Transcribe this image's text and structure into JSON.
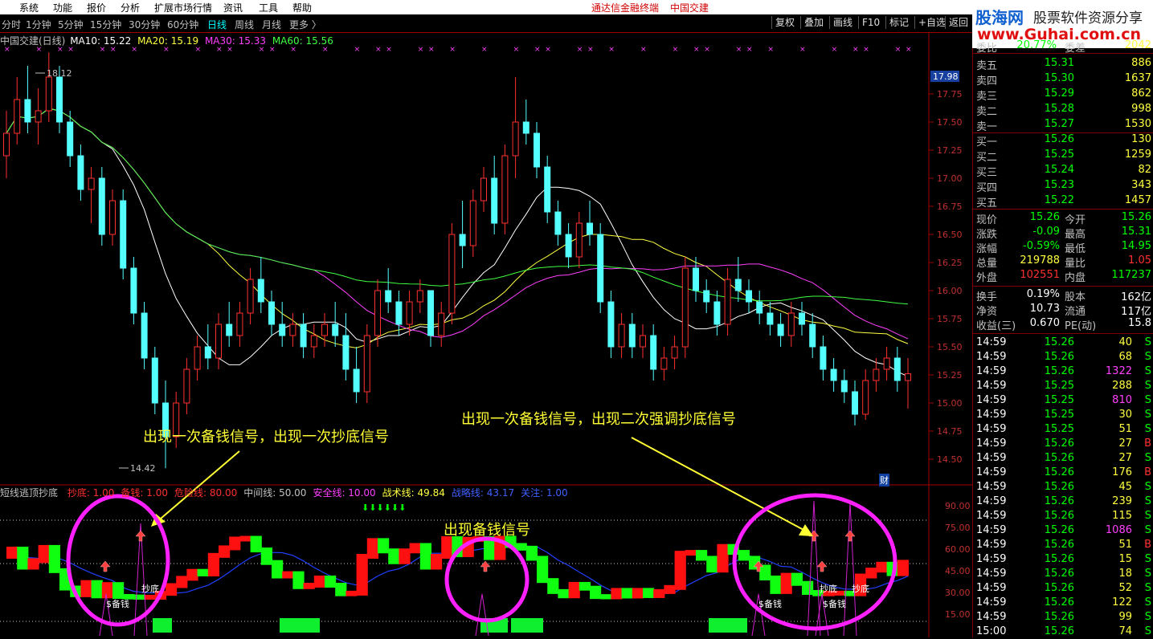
{
  "menu": {
    "items": [
      "系统",
      "功能",
      "报价",
      "分析",
      "扩展市场行情",
      "资讯",
      "工具",
      "帮助"
    ],
    "app_title": "通达信金融终端",
    "stock_title": "中国交建"
  },
  "timeframes": [
    "分时",
    "1分钟",
    "5分钟",
    "15分钟",
    "30分钟",
    "60分钟",
    "日线",
    "周线",
    "月线",
    "更多 〉"
  ],
  "active_timeframe": "日线",
  "toolbar_buttons": [
    "复权",
    "叠加",
    "画线",
    "F10",
    "标记",
    "+自选",
    "返回"
  ],
  "logo": {
    "brand": "股海网",
    "tagline": "股票软件资源分享",
    "url": "www.Guhai.com.cn"
  },
  "legend": {
    "name": "中国交建(日线)",
    "ma10": "MA10: 15.22",
    "ma20": "MA20: 15.19",
    "ma30": "MA30: 15.33",
    "ma60": "MA60: 15.56"
  },
  "price_axis": {
    "ticks": [
      "17.75",
      "17.50",
      "17.25",
      "17.00",
      "16.75",
      "16.50",
      "16.25",
      "16.00",
      "15.75",
      "15.50",
      "15.25",
      "15.00",
      "14.75",
      "14.50"
    ],
    "current": "17.98"
  },
  "hi_lo": {
    "high": "18.12",
    "low": "14.42"
  },
  "indicator": {
    "title": "短线逃顶抄底",
    "items": [
      {
        "label": "抄底: 1.00",
        "color": "#ff3030"
      },
      {
        "label": "备钱: 1.00",
        "color": "#ff3030"
      },
      {
        "label": "危险线: 80.00",
        "color": "#ff3030"
      },
      {
        "label": "中间线: 50.00",
        "color": "#c0c0c0"
      },
      {
        "label": "安全线: 10.00",
        "color": "#ff40ff"
      },
      {
        "label": "战术线: 49.84",
        "color": "#ffff40"
      },
      {
        "label": "战略线: 43.17",
        "color": "#4060ff"
      },
      {
        "label": "关注: 1.00",
        "color": "#4060ff"
      }
    ],
    "axis_ticks": [
      "90.00",
      "75.00",
      "60.00",
      "45.00",
      "30.00",
      "15.00"
    ],
    "signal_beiqian": "$备钱",
    "signal_chaodi": "抄底"
  },
  "annotations": {
    "left": "出现一次备钱信号，出现一次抄底信号",
    "right": "出现一次备钱信号，出现二次强调抄底信号",
    "middle": "出现备钱信号"
  },
  "marker_cai": "财",
  "order_book": {
    "top_label_a": "委比",
    "top_value_a": "20.77%",
    "top_label_b": "委差",
    "top_value_b": "2042",
    "asks": [
      {
        "label": "卖五",
        "price": "15.31",
        "vol": "886"
      },
      {
        "label": "卖四",
        "price": "15.30",
        "vol": "1637"
      },
      {
        "label": "卖三",
        "price": "15.29",
        "vol": "862"
      },
      {
        "label": "卖二",
        "price": "15.28",
        "vol": "998"
      },
      {
        "label": "卖一",
        "price": "15.27",
        "vol": "1530"
      }
    ],
    "bids": [
      {
        "label": "买一",
        "price": "15.26",
        "vol": "130"
      },
      {
        "label": "买二",
        "price": "15.25",
        "vol": "1259"
      },
      {
        "label": "买三",
        "price": "15.24",
        "vol": "82"
      },
      {
        "label": "买四",
        "price": "15.23",
        "vol": "343"
      },
      {
        "label": "买五",
        "price": "15.22",
        "vol": "1457"
      }
    ]
  },
  "quote_stats": [
    {
      "l1": "现价",
      "v1": "15.26",
      "c1": "#00ff00",
      "l2": "今开",
      "v2": "15.26",
      "c2": "#00ff00"
    },
    {
      "l1": "涨跌",
      "v1": "-0.09",
      "c1": "#00ff00",
      "l2": "最高",
      "v2": "15.31",
      "c2": "#00ff00"
    },
    {
      "l1": "涨幅",
      "v1": "-0.59%",
      "c1": "#00ff00",
      "l2": "最低",
      "v2": "14.95",
      "c2": "#00ff00"
    },
    {
      "l1": "总量",
      "v1": "219788",
      "c1": "#ffff40",
      "l2": "量比",
      "v2": "1.05",
      "c2": "#ff3030"
    },
    {
      "l1": "外盘",
      "v1": "102551",
      "c1": "#ff3030",
      "l2": "内盘",
      "v2": "117237",
      "c2": "#00ff00"
    }
  ],
  "fundamentals": [
    {
      "l1": "换手",
      "v1": "0.19%",
      "l2": "股本",
      "v2": "162亿"
    },
    {
      "l1": "净资",
      "v1": "10.73",
      "l2": "流通",
      "v2": "117亿"
    },
    {
      "l1": "收益(三)",
      "v1": "0.670",
      "l2": "PE(动)",
      "v2": "15.8"
    }
  ],
  "ticks": [
    {
      "t": "14:59",
      "p": "15.26",
      "v": "40",
      "s": "S"
    },
    {
      "t": "14:59",
      "p": "15.26",
      "v": "68",
      "s": "S"
    },
    {
      "t": "14:59",
      "p": "15.26",
      "v": "1322",
      "s": "S"
    },
    {
      "t": "14:59",
      "p": "15.25",
      "v": "288",
      "s": "S"
    },
    {
      "t": "14:59",
      "p": "15.25",
      "v": "810",
      "s": "S"
    },
    {
      "t": "14:59",
      "p": "15.25",
      "v": "30",
      "s": "S"
    },
    {
      "t": "14:59",
      "p": "15.25",
      "v": "51",
      "s": "S"
    },
    {
      "t": "14:59",
      "p": "15.26",
      "v": "27",
      "s": "B"
    },
    {
      "t": "14:59",
      "p": "15.26",
      "v": "27",
      "s": "S"
    },
    {
      "t": "14:59",
      "p": "15.26",
      "v": "176",
      "s": "B"
    },
    {
      "t": "14:59",
      "p": "15.26",
      "v": "45",
      "s": "S"
    },
    {
      "t": "14:59",
      "p": "15.26",
      "v": "239",
      "s": "S"
    },
    {
      "t": "14:59",
      "p": "15.26",
      "v": "115",
      "s": "S"
    },
    {
      "t": "14:59",
      "p": "15.26",
      "v": "1086",
      "s": "S"
    },
    {
      "t": "14:59",
      "p": "15.26",
      "v": "51",
      "s": "B"
    },
    {
      "t": "14:59",
      "p": "15.26",
      "v": "15",
      "s": "S"
    },
    {
      "t": "14:59",
      "p": "15.26",
      "v": "18",
      "s": "S"
    },
    {
      "t": "14:59",
      "p": "15.26",
      "v": "52",
      "s": "S"
    },
    {
      "t": "14:59",
      "p": "15.26",
      "v": "122",
      "s": "S"
    },
    {
      "t": "14:59",
      "p": "15.26",
      "v": "99",
      "s": "S"
    },
    {
      "t": "15:00",
      "p": "15.26",
      "v": "74",
      "s": "S"
    }
  ],
  "chart_data": {
    "type": "candlestick",
    "ohlc": [
      [
        17.2,
        17.6,
        17.0,
        17.4
      ],
      [
        17.4,
        17.9,
        17.3,
        17.7
      ],
      [
        17.7,
        18.0,
        17.4,
        17.5
      ],
      [
        17.5,
        17.8,
        17.3,
        17.6
      ],
      [
        17.6,
        18.12,
        17.5,
        17.9
      ],
      [
        17.9,
        18.0,
        17.4,
        17.5
      ],
      [
        17.5,
        17.6,
        17.1,
        17.2
      ],
      [
        17.2,
        17.3,
        16.8,
        16.9
      ],
      [
        16.9,
        17.1,
        16.6,
        17.0
      ],
      [
        17.0,
        17.1,
        16.4,
        16.5
      ],
      [
        16.5,
        16.9,
        16.4,
        16.8
      ],
      [
        16.8,
        16.9,
        16.1,
        16.2
      ],
      [
        16.2,
        16.3,
        15.7,
        15.8
      ],
      [
        15.8,
        15.9,
        15.3,
        15.4
      ],
      [
        15.4,
        15.5,
        14.9,
        15.0
      ],
      [
        15.0,
        15.2,
        14.42,
        14.7
      ],
      [
        14.7,
        15.1,
        14.6,
        15.0
      ],
      [
        15.0,
        15.4,
        14.9,
        15.3
      ],
      [
        15.3,
        15.6,
        15.2,
        15.5
      ],
      [
        15.5,
        15.7,
        15.3,
        15.4
      ],
      [
        15.4,
        15.8,
        15.3,
        15.7
      ],
      [
        15.7,
        15.9,
        15.5,
        15.6
      ],
      [
        15.6,
        15.9,
        15.5,
        15.8
      ],
      [
        15.8,
        16.2,
        15.7,
        16.1
      ],
      [
        16.1,
        16.3,
        15.8,
        15.9
      ],
      [
        15.9,
        16.0,
        15.6,
        15.7
      ],
      [
        15.7,
        15.9,
        15.5,
        15.6
      ],
      [
        15.6,
        15.8,
        15.5,
        15.7
      ],
      [
        15.7,
        15.8,
        15.4,
        15.5
      ],
      [
        15.5,
        15.7,
        15.4,
        15.6
      ],
      [
        15.6,
        15.8,
        15.5,
        15.7
      ],
      [
        15.7,
        15.9,
        15.5,
        15.6
      ],
      [
        15.6,
        15.8,
        15.2,
        15.3
      ],
      [
        15.3,
        15.5,
        15.0,
        15.1
      ],
      [
        15.1,
        15.7,
        15.0,
        15.6
      ],
      [
        15.6,
        16.1,
        15.5,
        16.0
      ],
      [
        16.0,
        16.2,
        15.8,
        15.9
      ],
      [
        15.9,
        16.0,
        15.6,
        15.7
      ],
      [
        15.7,
        16.0,
        15.6,
        15.9
      ],
      [
        15.9,
        16.1,
        15.8,
        16.0
      ],
      [
        16.0,
        16.0,
        15.5,
        15.6
      ],
      [
        15.6,
        15.9,
        15.5,
        15.8
      ],
      [
        15.8,
        16.6,
        15.7,
        16.5
      ],
      [
        16.5,
        16.8,
        16.2,
        16.4
      ],
      [
        16.4,
        16.9,
        16.3,
        16.8
      ],
      [
        16.8,
        17.1,
        16.7,
        17.0
      ],
      [
        17.0,
        17.2,
        16.5,
        16.6
      ],
      [
        16.6,
        17.3,
        16.5,
        17.2
      ],
      [
        17.2,
        17.9,
        17.0,
        17.5
      ],
      [
        17.5,
        17.7,
        17.3,
        17.4
      ],
      [
        17.4,
        17.5,
        17.0,
        17.1
      ],
      [
        17.1,
        17.2,
        16.6,
        16.7
      ],
      [
        16.7,
        16.8,
        16.4,
        16.5
      ],
      [
        16.5,
        16.6,
        16.2,
        16.3
      ],
      [
        16.3,
        16.7,
        16.2,
        16.6
      ],
      [
        16.6,
        16.8,
        16.4,
        16.5
      ],
      [
        16.5,
        16.6,
        15.8,
        15.9
      ],
      [
        15.9,
        16.0,
        15.4,
        15.5
      ],
      [
        15.5,
        15.8,
        15.4,
        15.7
      ],
      [
        15.7,
        15.8,
        15.4,
        15.5
      ],
      [
        15.5,
        15.7,
        15.4,
        15.6
      ],
      [
        15.6,
        15.7,
        15.2,
        15.3
      ],
      [
        15.3,
        15.5,
        15.2,
        15.4
      ],
      [
        15.4,
        15.6,
        15.3,
        15.5
      ],
      [
        15.5,
        16.3,
        15.4,
        16.2
      ],
      [
        16.2,
        16.3,
        15.9,
        16.0
      ],
      [
        16.0,
        16.1,
        15.8,
        15.9
      ],
      [
        15.9,
        16.0,
        15.6,
        15.7
      ],
      [
        15.7,
        16.2,
        15.6,
        16.1
      ],
      [
        16.1,
        16.3,
        15.9,
        16.0
      ],
      [
        16.0,
        16.1,
        15.8,
        15.9
      ],
      [
        15.9,
        16.0,
        15.7,
        15.8
      ],
      [
        15.8,
        15.9,
        15.6,
        15.7
      ],
      [
        15.7,
        15.8,
        15.5,
        15.6
      ],
      [
        15.6,
        15.9,
        15.5,
        15.8
      ],
      [
        15.8,
        15.9,
        15.6,
        15.7
      ],
      [
        15.7,
        15.8,
        15.4,
        15.5
      ],
      [
        15.5,
        15.6,
        15.2,
        15.3
      ],
      [
        15.3,
        15.4,
        15.1,
        15.2
      ],
      [
        15.2,
        15.3,
        15.0,
        15.1
      ],
      [
        15.1,
        15.2,
        14.8,
        14.9
      ],
      [
        14.9,
        15.3,
        14.85,
        15.2
      ],
      [
        15.2,
        15.4,
        15.1,
        15.3
      ],
      [
        15.3,
        15.5,
        15.2,
        15.4
      ],
      [
        15.4,
        15.5,
        15.1,
        15.2
      ],
      [
        15.2,
        15.4,
        14.95,
        15.26
      ]
    ],
    "ma_lines": [
      "MA10",
      "MA20",
      "MA30",
      "MA60"
    ],
    "ylim": [
      14.3,
      18.2
    ]
  }
}
